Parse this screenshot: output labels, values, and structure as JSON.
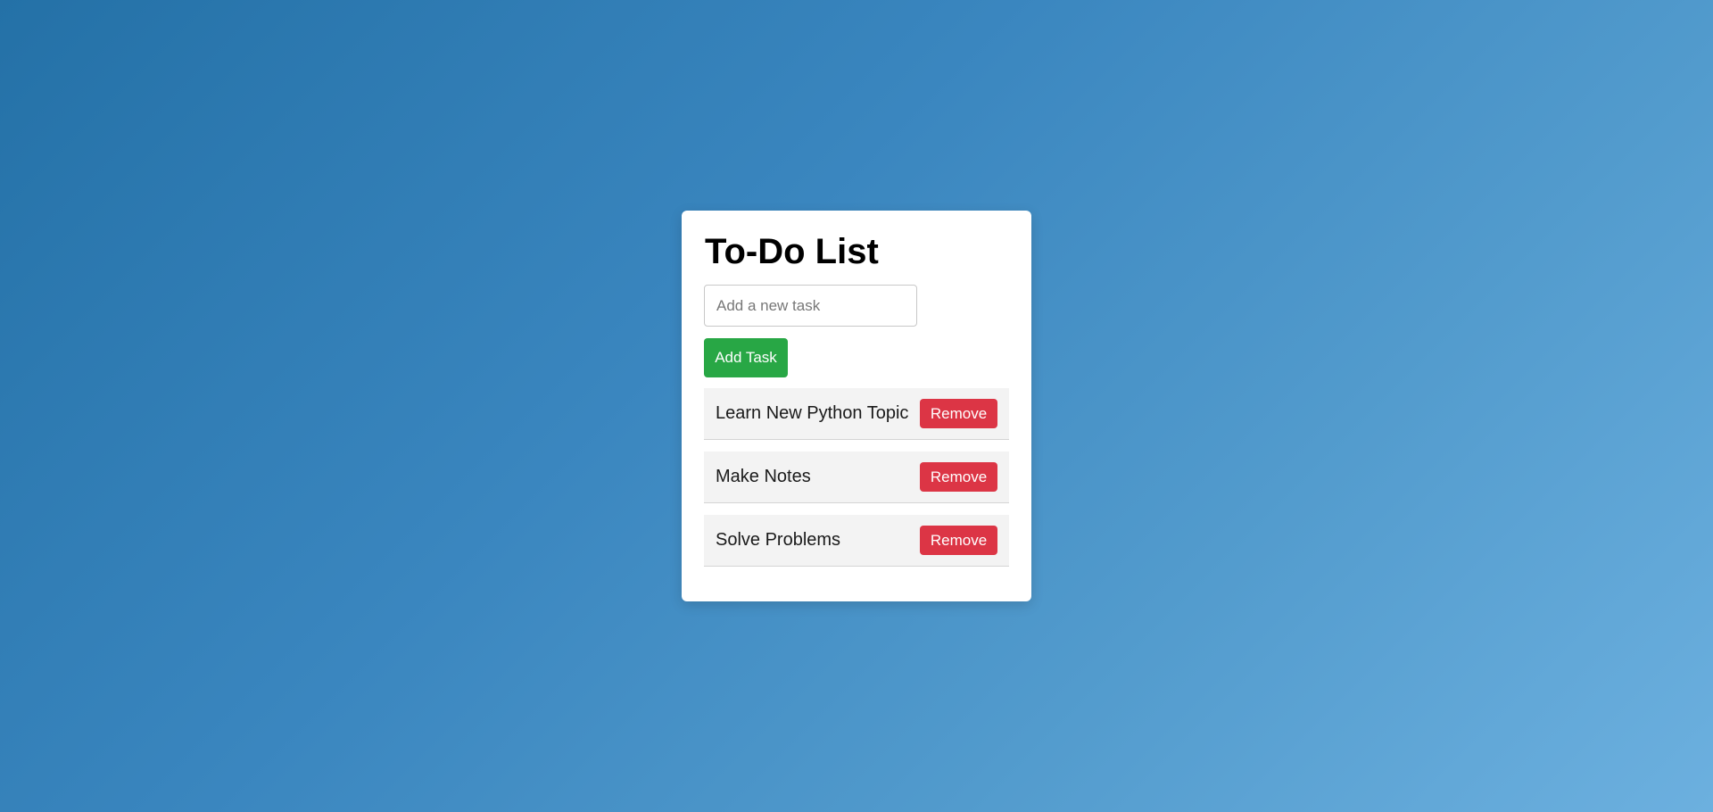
{
  "app": {
    "title": "To-Do List"
  },
  "input": {
    "placeholder": "Add a new task",
    "value": ""
  },
  "add_button": {
    "label": "Add Task"
  },
  "tasks": [
    {
      "text": "Learn New Python Topic",
      "remove_label": "Remove"
    },
    {
      "text": "Make Notes",
      "remove_label": "Remove"
    },
    {
      "text": "Solve Problems",
      "remove_label": "Remove"
    }
  ],
  "colors": {
    "background_gradient_start": "#2471a7",
    "background_gradient_end": "#6cb0df",
    "card": "#ffffff",
    "add_button": "#28a745",
    "remove_button": "#dc3545",
    "task_item": "#f3f3f3"
  }
}
